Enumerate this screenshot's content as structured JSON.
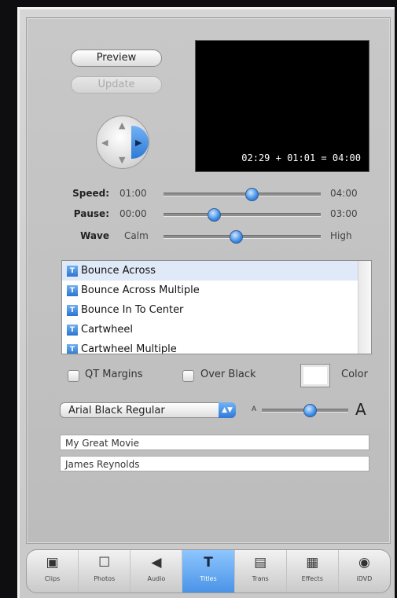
{
  "controls": {
    "preview_label": "Preview",
    "update_label": "Update"
  },
  "viewer": {
    "timecode": "02:29 + 01:01 = 04:00"
  },
  "sliders": [
    {
      "label": "Speed:",
      "min_label": "01:00",
      "max_label": "04:00",
      "value": 0.56
    },
    {
      "label": "Pause:",
      "min_label": "00:00",
      "max_label": "03:00",
      "value": 0.32
    },
    {
      "label": "Wave",
      "min_label": "Calm",
      "max_label": "High",
      "value": 0.46
    }
  ],
  "titles_list": {
    "items": [
      "Bounce Across",
      "Bounce Across Multiple",
      "Bounce In To Center",
      "Cartwheel",
      "Cartwheel Multiple"
    ],
    "selected": "Bounce Across"
  },
  "options": {
    "qt_margins": "QT Margins",
    "over_black": "Over Black",
    "color": "Color"
  },
  "font": {
    "selected": "Arial Black Regular",
    "small_a": "A",
    "large_a": "A",
    "size_value": 0.55
  },
  "text_fields": [
    "My Great Movie",
    "James Reynolds"
  ],
  "toolbar": {
    "tabs": [
      {
        "icon": "clips-icon",
        "glyph": "▣",
        "label": "Clips"
      },
      {
        "icon": "photos-icon",
        "glyph": "☐",
        "label": "Photos"
      },
      {
        "icon": "audio-icon",
        "glyph": "◀",
        "label": "Audio"
      },
      {
        "icon": "titles-icon",
        "glyph": "T",
        "label": "Titles"
      },
      {
        "icon": "trans-icon",
        "glyph": "▤",
        "label": "Trans"
      },
      {
        "icon": "effects-icon",
        "glyph": "▦",
        "label": "Effects"
      },
      {
        "icon": "idvd-icon",
        "glyph": "◉",
        "label": "iDVD"
      }
    ],
    "active": "Titles"
  },
  "colors": {
    "accent": "#3d8de6",
    "panel": "#c6c6c6",
    "viewer": "#000000"
  }
}
